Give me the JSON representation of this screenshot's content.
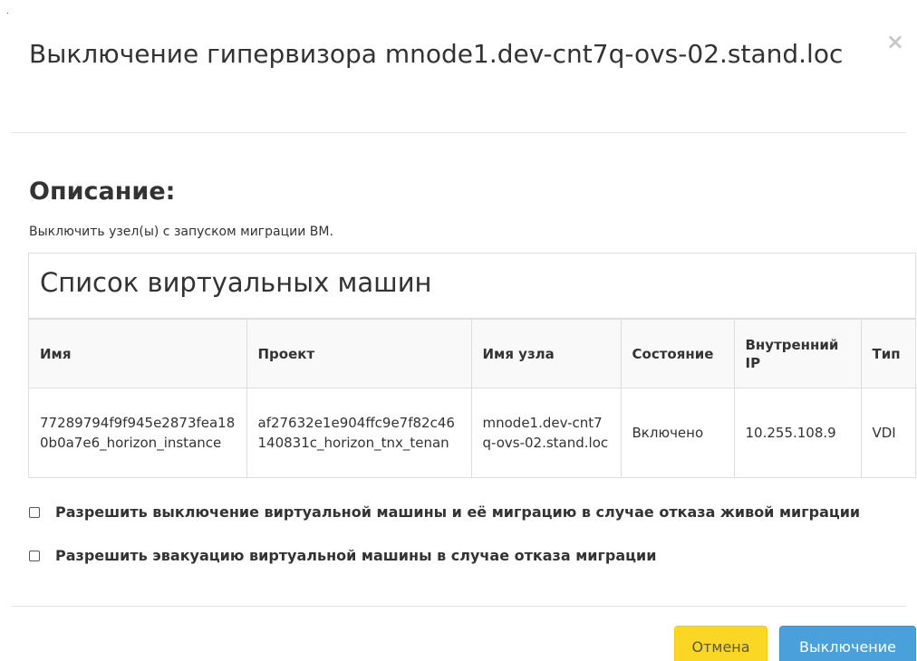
{
  "modal": {
    "title": "Выключение гипервизора mnode1.dev-cnt7q-ovs-02.stand.loc",
    "close_symbol": "×"
  },
  "description_section": {
    "heading": "Описание:",
    "text": "Выключить узел(ы) с запуском миграции ВМ."
  },
  "vm_list": {
    "title": "Список виртуальных машин",
    "columns": [
      "Имя",
      "Проект",
      "Имя узла",
      "Состояние",
      "Внутренний IP",
      "Тип"
    ],
    "rows": [
      {
        "name": "77289794f9f945e2873fea180b0a7e6_horizon_instance",
        "project": "af27632e1e904ffc9e7f82c46140831c_horizon_tnx_tenan",
        "node": "mnode1.dev-cnt7q-ovs-02.stand.loc",
        "state": "Включено",
        "ip": "10.255.108.9",
        "type": "VDI"
      }
    ]
  },
  "options": {
    "allow_shutdown_label": "Разрешить выключение виртуальной машины и её миграцию в случае отказа живой миграции",
    "allow_evacuation_label": "Разрешить эвакуацию виртуальной машины в случае отказа миграции"
  },
  "footer": {
    "cancel_label": "Отмена",
    "confirm_label": "Выключение"
  },
  "colors": {
    "cancel_bg": "#fad724",
    "confirm_bg": "#4aa0db"
  }
}
